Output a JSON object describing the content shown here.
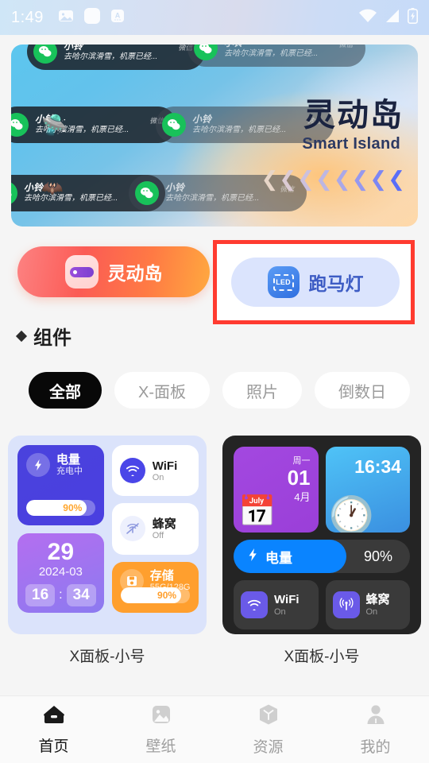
{
  "status_bar": {
    "time": "1:49",
    "left_icons": [
      "image-icon",
      "rounded-square-icon",
      "input-method-a-icon"
    ],
    "right_icons": [
      "wifi-icon",
      "cellular-signal-icon",
      "battery-charging-icon"
    ]
  },
  "banner": {
    "title": "灵动岛",
    "subtitle": "Smart Island",
    "notifications": [
      {
        "name": "小铃",
        "message": "去哈尔滨滑雪，机票已经...",
        "app": "微信"
      },
      {
        "name": "小铃",
        "message": "去哈尔滨滑雪，机票已经...",
        "app": "微信"
      },
      {
        "name": "小铃",
        "message": "去哈尔滨滑雪，机票已经...",
        "app": "微信"
      },
      {
        "name": "小铃",
        "message": "去哈尔滨滑雪，机票已经...",
        "app": "微信"
      },
      {
        "name": "小铃",
        "message": "去哈尔滨滑雪，机票已经...",
        "app": "微信"
      },
      {
        "name": "小铃",
        "message": "去哈尔滨滑雪，机票已经...",
        "app": "微信"
      }
    ],
    "carousel_dots": 3,
    "active_dot": 0
  },
  "actions": {
    "island": {
      "label": "灵动岛",
      "icon": "dynamic-island-icon",
      "accent": "#fb5b55"
    },
    "marquee": {
      "label": "跑马灯",
      "icon": "led-icon",
      "accent": "#3d5cc4",
      "selected": true,
      "highlight_color": "#ff3b30"
    }
  },
  "section": {
    "title": "组件",
    "chips": [
      {
        "label": "全部",
        "active": true
      },
      {
        "label": "X-面板",
        "active": false
      },
      {
        "label": "照片",
        "active": false
      },
      {
        "label": "倒数日",
        "active": false
      }
    ]
  },
  "widgets": [
    {
      "label": "X面板-小号",
      "theme": "light",
      "tiles": {
        "battery": {
          "title": "电量",
          "status": "充电中",
          "percent": "90%"
        },
        "date": {
          "day": "29",
          "year_month": "2024-03",
          "hour": "16",
          "sep": ":",
          "minute": "34"
        },
        "wifi": {
          "title": "WiFi",
          "status": "On"
        },
        "cellular": {
          "title": "蜂窝",
          "status": "Off"
        },
        "storage": {
          "title": "存储",
          "status": "55G/128G",
          "percent": "90%"
        }
      }
    },
    {
      "label": "X面板-小号",
      "theme": "dark",
      "tiles": {
        "calendar": {
          "weekday": "周一",
          "day": "01",
          "month": "4月"
        },
        "clock": {
          "time": "16:34"
        },
        "battery": {
          "title": "电量",
          "percent": "90%"
        },
        "wifi": {
          "title": "WiFi",
          "status": "On"
        },
        "cellular": {
          "title": "蜂窝",
          "status": "On"
        }
      }
    }
  ],
  "nav": [
    {
      "label": "首页",
      "icon": "home-icon",
      "active": true
    },
    {
      "label": "壁纸",
      "icon": "image-icon",
      "active": false
    },
    {
      "label": "资源",
      "icon": "cube-icon",
      "active": false
    },
    {
      "label": "我的",
      "icon": "person-icon",
      "active": false
    }
  ]
}
